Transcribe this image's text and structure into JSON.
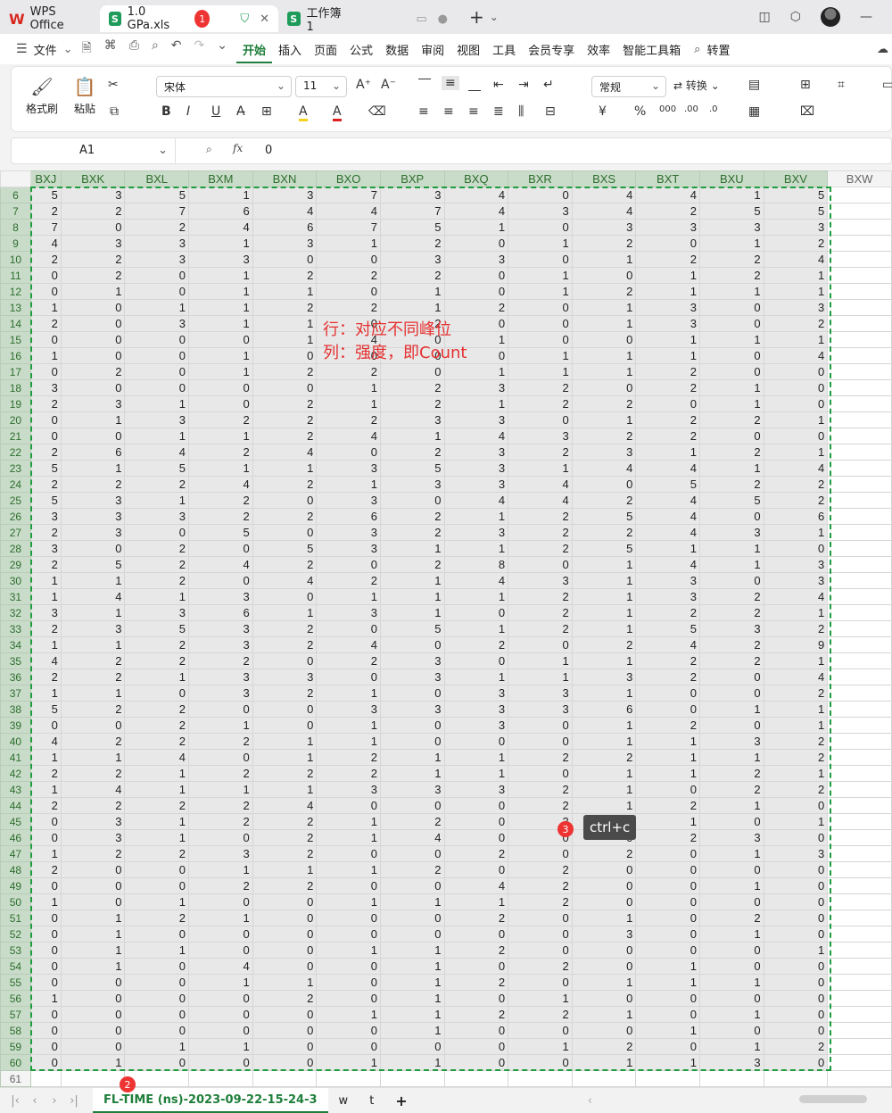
{
  "titlebar": {
    "wps_label": "WPS Office",
    "active_tab": "1.0 GPa.xls",
    "active_badge": "1",
    "other_tab": "工作簿1",
    "new_tab_symbol": "+"
  },
  "menu": {
    "file": "文件",
    "items": [
      "开始",
      "插入",
      "页面",
      "公式",
      "数据",
      "审阅",
      "视图",
      "工具",
      "会员专享",
      "效率",
      "智能工具箱"
    ],
    "search_label": "转置"
  },
  "ribbon": {
    "format_painter": "格式刷",
    "paste": "粘贴",
    "font_name": "宋体",
    "font_size": "11",
    "number_format": "常规",
    "convert": "转换"
  },
  "formula_bar": {
    "cell_ref": "A1",
    "fx": "fx",
    "value": "0"
  },
  "columns": [
    "BXJ",
    "BXK",
    "BXL",
    "BXM",
    "BXN",
    "BXO",
    "BXP",
    "BXQ",
    "BXR",
    "BXS",
    "BXT",
    "BXU",
    "BXV",
    "BXW"
  ],
  "row_start": 6,
  "extra_row": "61",
  "rows": [
    [
      5,
      3,
      5,
      1,
      3,
      7,
      3,
      4,
      0,
      4,
      4,
      1,
      5
    ],
    [
      2,
      2,
      7,
      6,
      4,
      4,
      7,
      4,
      3,
      4,
      2,
      5,
      5
    ],
    [
      7,
      0,
      2,
      4,
      6,
      7,
      5,
      1,
      0,
      3,
      3,
      3,
      3
    ],
    [
      4,
      3,
      3,
      1,
      3,
      1,
      2,
      0,
      1,
      2,
      0,
      1,
      2
    ],
    [
      2,
      2,
      3,
      3,
      0,
      0,
      3,
      3,
      0,
      1,
      2,
      2,
      4
    ],
    [
      0,
      2,
      0,
      1,
      2,
      2,
      2,
      0,
      1,
      0,
      1,
      2,
      1
    ],
    [
      0,
      1,
      0,
      1,
      1,
      0,
      1,
      0,
      1,
      2,
      1,
      1,
      1
    ],
    [
      1,
      0,
      1,
      1,
      2,
      2,
      1,
      2,
      0,
      1,
      3,
      0,
      3
    ],
    [
      2,
      0,
      3,
      1,
      1,
      0,
      2,
      0,
      0,
      1,
      3,
      0,
      2
    ],
    [
      0,
      0,
      0,
      0,
      1,
      4,
      0,
      1,
      0,
      0,
      1,
      1,
      1
    ],
    [
      1,
      0,
      0,
      1,
      0,
      0,
      0,
      0,
      1,
      1,
      1,
      0,
      4
    ],
    [
      0,
      2,
      0,
      1,
      2,
      2,
      0,
      1,
      1,
      1,
      2,
      0,
      0
    ],
    [
      3,
      0,
      0,
      0,
      0,
      1,
      2,
      3,
      2,
      0,
      2,
      1,
      0
    ],
    [
      2,
      3,
      1,
      0,
      2,
      1,
      2,
      1,
      2,
      2,
      0,
      1,
      0
    ],
    [
      0,
      1,
      3,
      2,
      2,
      2,
      3,
      3,
      0,
      1,
      2,
      2,
      1
    ],
    [
      0,
      0,
      1,
      1,
      2,
      4,
      1,
      4,
      3,
      2,
      2,
      0,
      0
    ],
    [
      2,
      6,
      4,
      2,
      4,
      0,
      2,
      3,
      2,
      3,
      1,
      2,
      1
    ],
    [
      5,
      1,
      5,
      1,
      1,
      3,
      5,
      3,
      1,
      4,
      4,
      1,
      4
    ],
    [
      2,
      2,
      2,
      4,
      2,
      1,
      3,
      3,
      4,
      0,
      5,
      2,
      2
    ],
    [
      5,
      3,
      1,
      2,
      0,
      3,
      0,
      4,
      4,
      2,
      4,
      5,
      2
    ],
    [
      3,
      3,
      3,
      2,
      2,
      6,
      2,
      1,
      2,
      5,
      4,
      0,
      6
    ],
    [
      2,
      3,
      0,
      5,
      0,
      3,
      2,
      3,
      2,
      2,
      4,
      3,
      1
    ],
    [
      3,
      0,
      2,
      0,
      5,
      3,
      1,
      1,
      2,
      5,
      1,
      1,
      0
    ],
    [
      2,
      5,
      2,
      4,
      2,
      0,
      2,
      8,
      0,
      1,
      4,
      1,
      3
    ],
    [
      1,
      1,
      2,
      0,
      4,
      2,
      1,
      4,
      3,
      1,
      3,
      0,
      3
    ],
    [
      1,
      4,
      1,
      3,
      0,
      1,
      1,
      1,
      2,
      1,
      3,
      2,
      4
    ],
    [
      3,
      1,
      3,
      6,
      1,
      3,
      1,
      0,
      2,
      1,
      2,
      2,
      1
    ],
    [
      2,
      3,
      5,
      3,
      2,
      0,
      5,
      1,
      2,
      1,
      5,
      3,
      2
    ],
    [
      1,
      1,
      2,
      3,
      2,
      4,
      0,
      2,
      0,
      2,
      4,
      2,
      9
    ],
    [
      4,
      2,
      2,
      2,
      0,
      2,
      3,
      0,
      1,
      1,
      2,
      2,
      1
    ],
    [
      2,
      2,
      1,
      3,
      3,
      0,
      3,
      1,
      1,
      3,
      2,
      0,
      4
    ],
    [
      1,
      1,
      0,
      3,
      2,
      1,
      0,
      3,
      3,
      1,
      0,
      0,
      2
    ],
    [
      5,
      2,
      2,
      0,
      0,
      3,
      3,
      3,
      3,
      6,
      0,
      1,
      1
    ],
    [
      0,
      0,
      2,
      1,
      0,
      1,
      0,
      3,
      0,
      1,
      2,
      0,
      1
    ],
    [
      4,
      2,
      2,
      2,
      1,
      1,
      0,
      0,
      0,
      1,
      1,
      3,
      2
    ],
    [
      1,
      1,
      4,
      0,
      1,
      2,
      1,
      1,
      2,
      2,
      1,
      1,
      2
    ],
    [
      2,
      2,
      1,
      2,
      2,
      2,
      1,
      1,
      0,
      1,
      1,
      2,
      1
    ],
    [
      1,
      4,
      1,
      1,
      1,
      3,
      3,
      3,
      2,
      1,
      0,
      2,
      2
    ],
    [
      2,
      2,
      2,
      2,
      4,
      0,
      0,
      0,
      2,
      1,
      2,
      1,
      0
    ],
    [
      0,
      3,
      1,
      2,
      2,
      1,
      2,
      0,
      3,
      2,
      1,
      0,
      1
    ],
    [
      0,
      3,
      1,
      0,
      2,
      1,
      4,
      0,
      0,
      0,
      2,
      3,
      0
    ],
    [
      1,
      2,
      2,
      3,
      2,
      0,
      0,
      2,
      0,
      2,
      0,
      1,
      3
    ],
    [
      2,
      0,
      0,
      1,
      1,
      1,
      2,
      0,
      2,
      0,
      0,
      0,
      0
    ],
    [
      0,
      0,
      0,
      2,
      2,
      0,
      0,
      4,
      2,
      0,
      0,
      1,
      0
    ],
    [
      1,
      0,
      1,
      0,
      0,
      1,
      1,
      1,
      2,
      0,
      0,
      0,
      0
    ],
    [
      0,
      1,
      2,
      1,
      0,
      0,
      0,
      2,
      0,
      1,
      0,
      2,
      0
    ],
    [
      0,
      1,
      0,
      0,
      0,
      0,
      0,
      0,
      0,
      3,
      0,
      1,
      0
    ],
    [
      0,
      1,
      1,
      0,
      0,
      1,
      1,
      2,
      0,
      0,
      0,
      0,
      1
    ],
    [
      0,
      1,
      0,
      4,
      0,
      0,
      1,
      0,
      2,
      0,
      1,
      0,
      0
    ],
    [
      0,
      0,
      0,
      1,
      1,
      0,
      1,
      2,
      0,
      1,
      1,
      1,
      0
    ],
    [
      1,
      0,
      0,
      0,
      2,
      0,
      1,
      0,
      1,
      0,
      0,
      0,
      0
    ],
    [
      0,
      0,
      0,
      0,
      0,
      1,
      1,
      2,
      2,
      1,
      0,
      1,
      0
    ],
    [
      0,
      0,
      0,
      0,
      0,
      0,
      1,
      0,
      0,
      0,
      1,
      0,
      0
    ],
    [
      0,
      0,
      1,
      1,
      0,
      0,
      0,
      0,
      1,
      2,
      0,
      1,
      2
    ],
    [
      0,
      1,
      0,
      0,
      0,
      1,
      1,
      0,
      0,
      1,
      1,
      3,
      0
    ]
  ],
  "annotation": {
    "line1": "行：对应不同峰位",
    "line2": "列：强度，即Count"
  },
  "tooltip": {
    "text": "ctrl+c",
    "badge": "3"
  },
  "sheets": {
    "active": "FL-TIME (ns)-2023-09-22-15-24-3",
    "active_badge": "2",
    "others": [
      "w",
      "t"
    ],
    "add": "+"
  }
}
